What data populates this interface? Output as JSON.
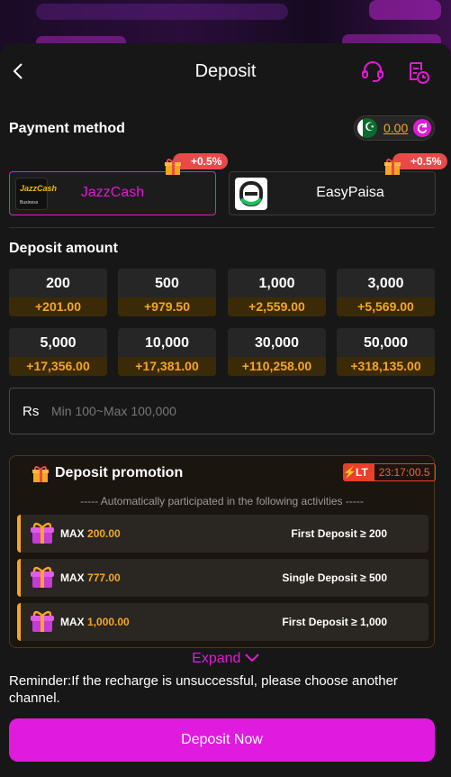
{
  "header": {
    "title": "Deposit"
  },
  "payment": {
    "title": "Payment method",
    "balance": "0.00",
    "flag": "☪",
    "methods": [
      {
        "name": "JazzCash",
        "logo_text": "JazzCash",
        "logo_sub": "Business",
        "bonus": "+0.5%",
        "selected": true
      },
      {
        "name": "EasyPaisa",
        "bonus": "+0.5%",
        "selected": false
      }
    ]
  },
  "amount": {
    "title": "Deposit amount",
    "options": [
      {
        "value": "200",
        "bonus": "+201.00"
      },
      {
        "value": "500",
        "bonus": "+979.50"
      },
      {
        "value": "1,000",
        "bonus": "+2,559.00"
      },
      {
        "value": "3,000",
        "bonus": "+5,569.00"
      },
      {
        "value": "5,000",
        "bonus": "+17,356.00"
      },
      {
        "value": "10,000",
        "bonus": "+17,381.00"
      },
      {
        "value": "30,000",
        "bonus": "+110,258.00"
      },
      {
        "value": "50,000",
        "bonus": "+318,135.00"
      }
    ],
    "currency": "Rs",
    "placeholder": "Min 100~Max 100,000"
  },
  "promotion": {
    "title": "Deposit promotion",
    "lt_label": "LT",
    "timer": "23:17:00.5",
    "subtitle": "----- Automatically participated in the following activities -----",
    "rows": [
      {
        "max_label": "MAX",
        "max_value": "200.00",
        "condition": "First Deposit ≥ 200"
      },
      {
        "max_label": "MAX",
        "max_value": "777.00",
        "condition": "Single Deposit ≥ 500"
      },
      {
        "max_label": "MAX",
        "max_value": "1,000.00",
        "condition": "First Deposit ≥ 1,000"
      }
    ],
    "expand": "Expand"
  },
  "reminder": "Reminder:If the recharge is unsuccessful, please choose another channel.",
  "submit": "Deposit Now",
  "colors": {
    "accent": "#e11ad6",
    "gold": "#f5a623",
    "bg": "#171717"
  }
}
